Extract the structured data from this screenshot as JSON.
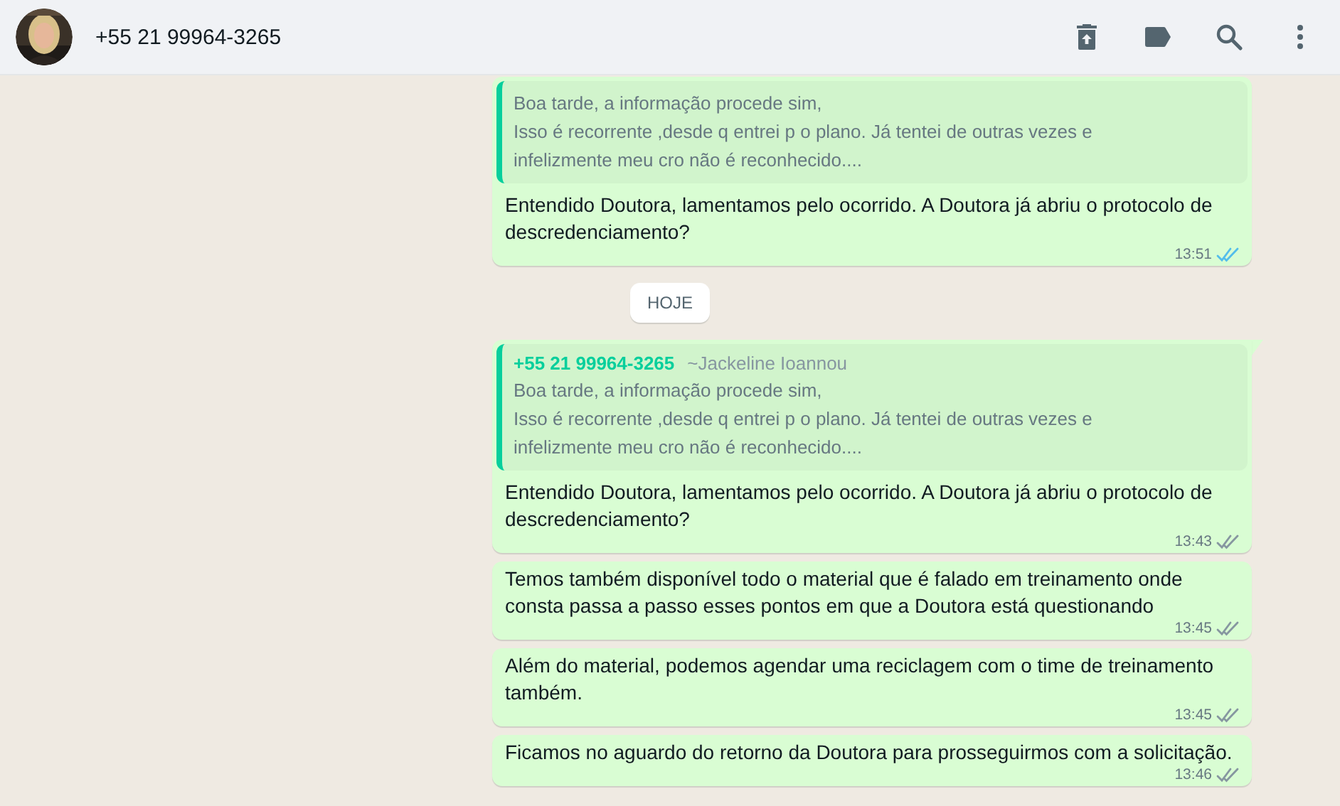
{
  "header": {
    "title": "+55 21 99964-3265"
  },
  "messages": [
    {
      "kind": "message",
      "tail": false,
      "quote": {
        "lines": [
          "Boa tarde, a informação procede sim,",
          "Isso é recorrente ,desde q entrei p o plano. Já tentei de outras vezes e",
          "infelizmente meu cro não é reconhecido...."
        ]
      },
      "text": "Entendido Doutora, lamentamos pelo ocorrido. A Doutora já abriu o protocolo de descredenciamento?",
      "time": "13:51",
      "read": true
    },
    {
      "kind": "date",
      "label": "HOJE"
    },
    {
      "kind": "message",
      "tail": true,
      "quote": {
        "sender": "+55 21 99964-3265",
        "alias": "~Jackeline Ioannou",
        "lines": [
          "Boa tarde, a informação procede sim,",
          "Isso é recorrente ,desde q entrei p o plano. Já tentei de outras vezes e",
          "infelizmente meu cro não é reconhecido...."
        ]
      },
      "text": "Entendido Doutora, lamentamos pelo ocorrido. A Doutora já abriu o protocolo de descredenciamento?",
      "time": "13:43",
      "read": false
    },
    {
      "kind": "message",
      "tail": false,
      "text": "Temos também disponível todo o material que é falado em treinamento onde consta passa a passo esses pontos em que a Doutora está questionando",
      "time": "13:45",
      "read": false
    },
    {
      "kind": "message",
      "tail": false,
      "text": "Além do material, podemos agendar uma reciclagem com o time de treinamento também.",
      "time": "13:45",
      "read": false
    },
    {
      "kind": "message",
      "tail": false,
      "text": "Ficamos no aguardo do retorno da Doutora para prosseguirmos com a solicitação.",
      "time": "13:46",
      "read": false
    }
  ]
}
